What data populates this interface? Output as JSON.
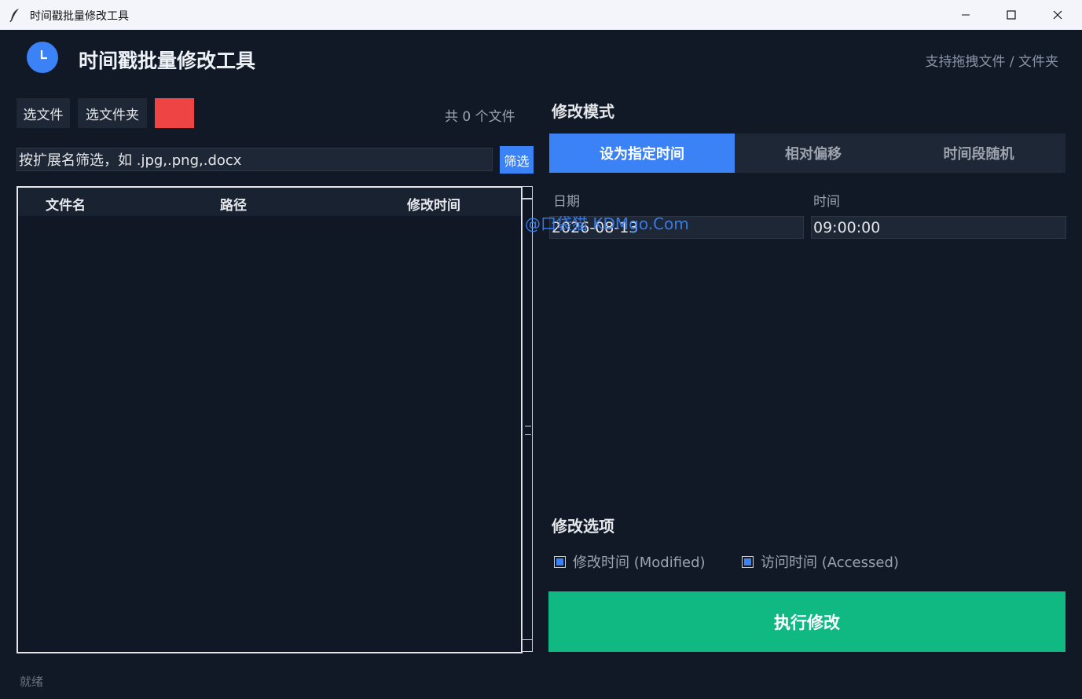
{
  "window": {
    "title": "时间戳批量修改工具",
    "icon": "feather-icon",
    "controls": [
      "minimize-icon",
      "maximize-icon",
      "close-icon"
    ]
  },
  "header": {
    "title": "时间戳批量修改工具",
    "icon": "clock-icon",
    "drag_hint": "支持拖拽文件 / 文件夹"
  },
  "toolbar": {
    "select_file": "选文件",
    "select_folder": "选文件夹",
    "file_count": "共 0 个文件",
    "filter_placeholder": "按扩展名筛选，如 .jpg,.png,.docx",
    "filter_button": "筛选"
  },
  "table": {
    "columns": [
      "文件名",
      "路径",
      "修改时间"
    ],
    "rows": []
  },
  "mode": {
    "title": "修改模式",
    "tabs": [
      "设为指定时间",
      "相对偏移",
      "时间段随机"
    ],
    "active_tab": 0
  },
  "fields": {
    "date_label": "日期",
    "date_value": "2026-08-13",
    "time_label": "时间",
    "time_value": "09:00:00"
  },
  "watermark": "@口袋猫 KDMgo.Com",
  "options": {
    "title": "修改选项",
    "modified_label": "修改时间 (Modified)",
    "modified_checked": true,
    "accessed_label": "访问时间 (Accessed)",
    "accessed_checked": true
  },
  "execute_button": "执行修改",
  "status": "就绪",
  "colors": {
    "background": "#111927",
    "accent": "#3b82f6",
    "execute": "#10b981",
    "clear": "#ef4444"
  }
}
